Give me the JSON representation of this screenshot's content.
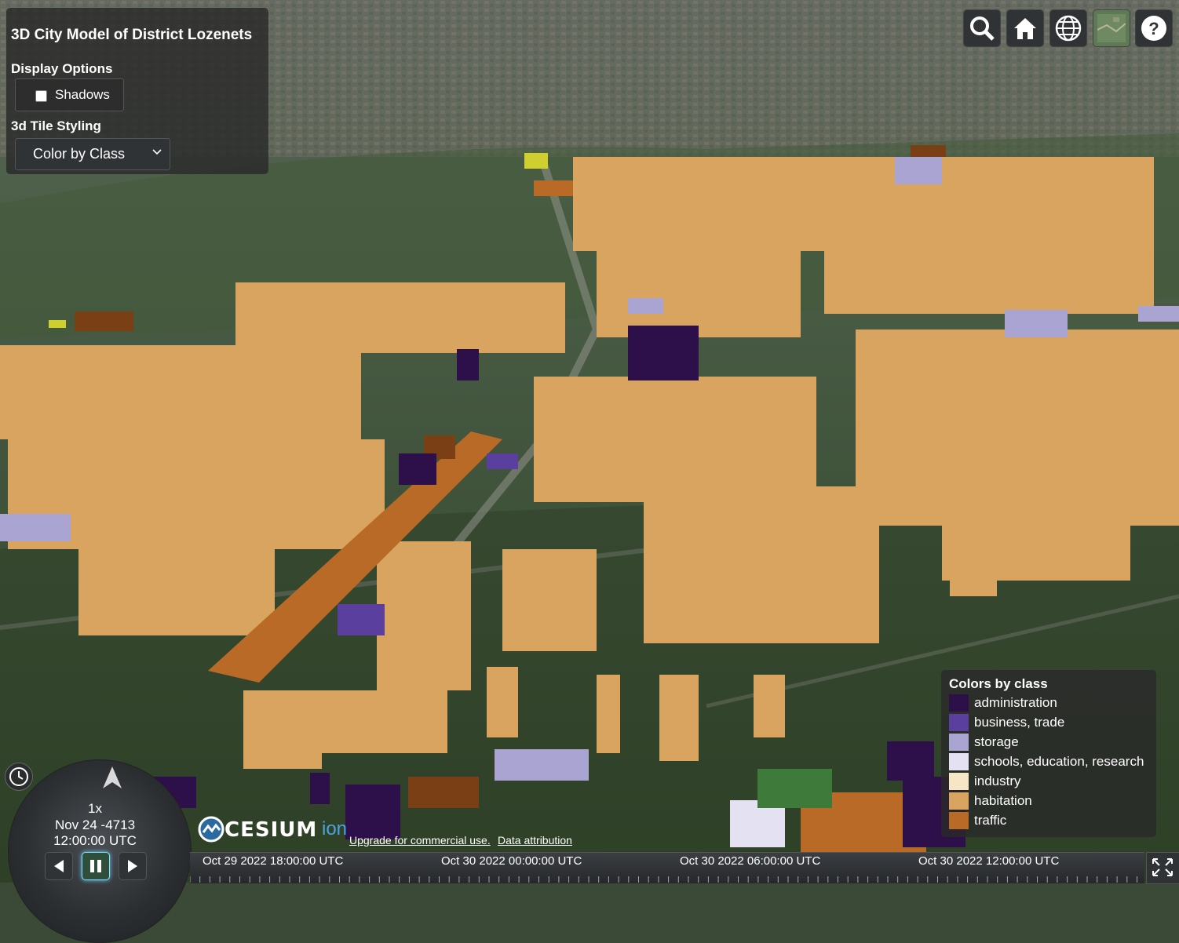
{
  "panel": {
    "title": "3D City Model of District Lozenets",
    "display_options_label": "Display Options",
    "shadows_label": "Shadows",
    "shadows_checked": false,
    "styling_label": "3d Tile Styling",
    "styling_selected": "Color by Class"
  },
  "toolbar": {
    "icons": [
      "search-icon",
      "home-icon",
      "globe-icon",
      "map-layer-icon",
      "help-icon"
    ]
  },
  "legend": {
    "title": "Colors by class",
    "items": [
      {
        "label": "administration",
        "color": "#2d0f4a"
      },
      {
        "label": "business, trade",
        "color": "#5b3f9e"
      },
      {
        "label": "storage",
        "color": "#a9a4d1"
      },
      {
        "label": "schools, education, research",
        "color": "#e4e2f2"
      },
      {
        "label": "industry",
        "color": "#f7e6c6"
      },
      {
        "label": "habitation",
        "color": "#d9a45f"
      },
      {
        "label": "traffic",
        "color": "#b86a26"
      }
    ]
  },
  "animation": {
    "speed": "1x",
    "date": "Nov 24 -4713",
    "time": "12:00:00 UTC"
  },
  "credits": {
    "logo_text": "CESIUM",
    "logo_suffix": "ion",
    "upgrade_link": "Upgrade for commercial use.",
    "attribution_link": "Data attribution"
  },
  "timeline": {
    "labels": [
      "Oct 29 2022 18:00:00 UTC",
      "Oct 30 2022 00:00:00 UTC",
      "Oct 30 2022 06:00:00 UTC",
      "Oct 30 2022 12:00:00 UTC"
    ]
  },
  "colors": {
    "panel_bg": "#2a2a2a",
    "button_bg": "#303336"
  }
}
